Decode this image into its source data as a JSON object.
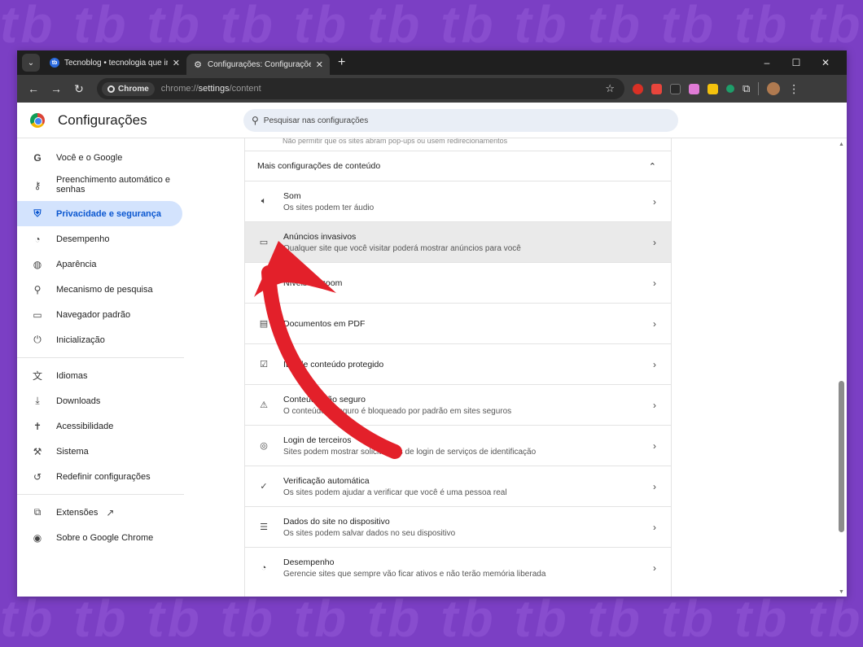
{
  "browser": {
    "tabs": [
      {
        "label": "Tecnoblog • tecnologia que inte",
        "favicon": "tb-icon",
        "active": false
      },
      {
        "label": "Configurações: Configurações d",
        "favicon": "gear-icon",
        "active": true
      }
    ],
    "new_tab": "+",
    "window_controls": {
      "minimize": "–",
      "maximize": "☐",
      "close": "✕"
    },
    "chip": "Chrome",
    "url_prefix": "chrome://",
    "url_main": "settings",
    "url_suffix": "/content"
  },
  "settings": {
    "title": "Configurações",
    "search_placeholder": "Pesquisar nas configurações"
  },
  "sidebar": {
    "items": [
      {
        "label": "Você e o Google",
        "icon": "google-g-icon"
      },
      {
        "label": "Preenchimento automático e senhas",
        "icon": "key-icon"
      },
      {
        "label": "Privacidade e segurança",
        "icon": "shield-icon",
        "active": true
      },
      {
        "label": "Desempenho",
        "icon": "gauge-icon"
      },
      {
        "label": "Aparência",
        "icon": "palette-icon"
      },
      {
        "label": "Mecanismo de pesquisa",
        "icon": "search-icon"
      },
      {
        "label": "Navegador padrão",
        "icon": "browser-window-icon"
      },
      {
        "label": "Inicialização",
        "icon": "power-icon"
      },
      {
        "label": "Idiomas",
        "icon": "translate-icon"
      },
      {
        "label": "Downloads",
        "icon": "download-icon"
      },
      {
        "label": "Acessibilidade",
        "icon": "accessibility-icon"
      },
      {
        "label": "Sistema",
        "icon": "wrench-icon"
      },
      {
        "label": "Redefinir configurações",
        "icon": "reset-icon"
      },
      {
        "label": "Extensões",
        "icon": "puzzle-icon"
      },
      {
        "label": "Sobre o Google Chrome",
        "icon": "chrome-icon"
      }
    ]
  },
  "content": {
    "cut_text": "Não permitir que os sites abram pop-ups ou usem redirecionamentos",
    "section_title": "Mais configurações de conteúdo",
    "rows": [
      {
        "title": "Som",
        "subtitle": "Os sites podem ter áudio",
        "icon": "speaker-icon"
      },
      {
        "title": "Anúncios invasivos",
        "subtitle": "Qualquer site que você visitar poderá mostrar anúncios para você",
        "icon": "ad-window-icon"
      },
      {
        "title": "Níveis de zoom",
        "subtitle": "",
        "icon": "zoom-icon"
      },
      {
        "title": "Documentos em PDF",
        "subtitle": "",
        "icon": "pdf-icon"
      },
      {
        "title": "IDs de conteúdo protegido",
        "subtitle": "",
        "icon": "protected-content-icon"
      },
      {
        "title": "Conteúdo não seguro",
        "subtitle": "O conteúdo inseguro é bloqueado por padrão em sites seguros",
        "icon": "warning-icon"
      },
      {
        "title": "Login de terceiros",
        "subtitle": "Sites podem mostrar solicitações de login de serviços de identificação",
        "icon": "account-circle-icon"
      },
      {
        "title": "Verificação automática",
        "subtitle": "Os sites podem ajudar a verificar que você é uma pessoa real",
        "icon": "person-check-icon"
      },
      {
        "title": "Dados do site no dispositivo",
        "subtitle": "Os sites podem salvar dados no seu dispositivo",
        "icon": "database-icon"
      },
      {
        "title": "Desempenho",
        "subtitle": "Gerencie sites que sempre vão ficar ativos e não terão memória liberada",
        "icon": "gauge-icon"
      }
    ]
  },
  "colors": {
    "background": "#7b3fc4",
    "active_nav": "#d3e3fd",
    "accent": "#0b57d0",
    "arrow": "#e3202a"
  }
}
